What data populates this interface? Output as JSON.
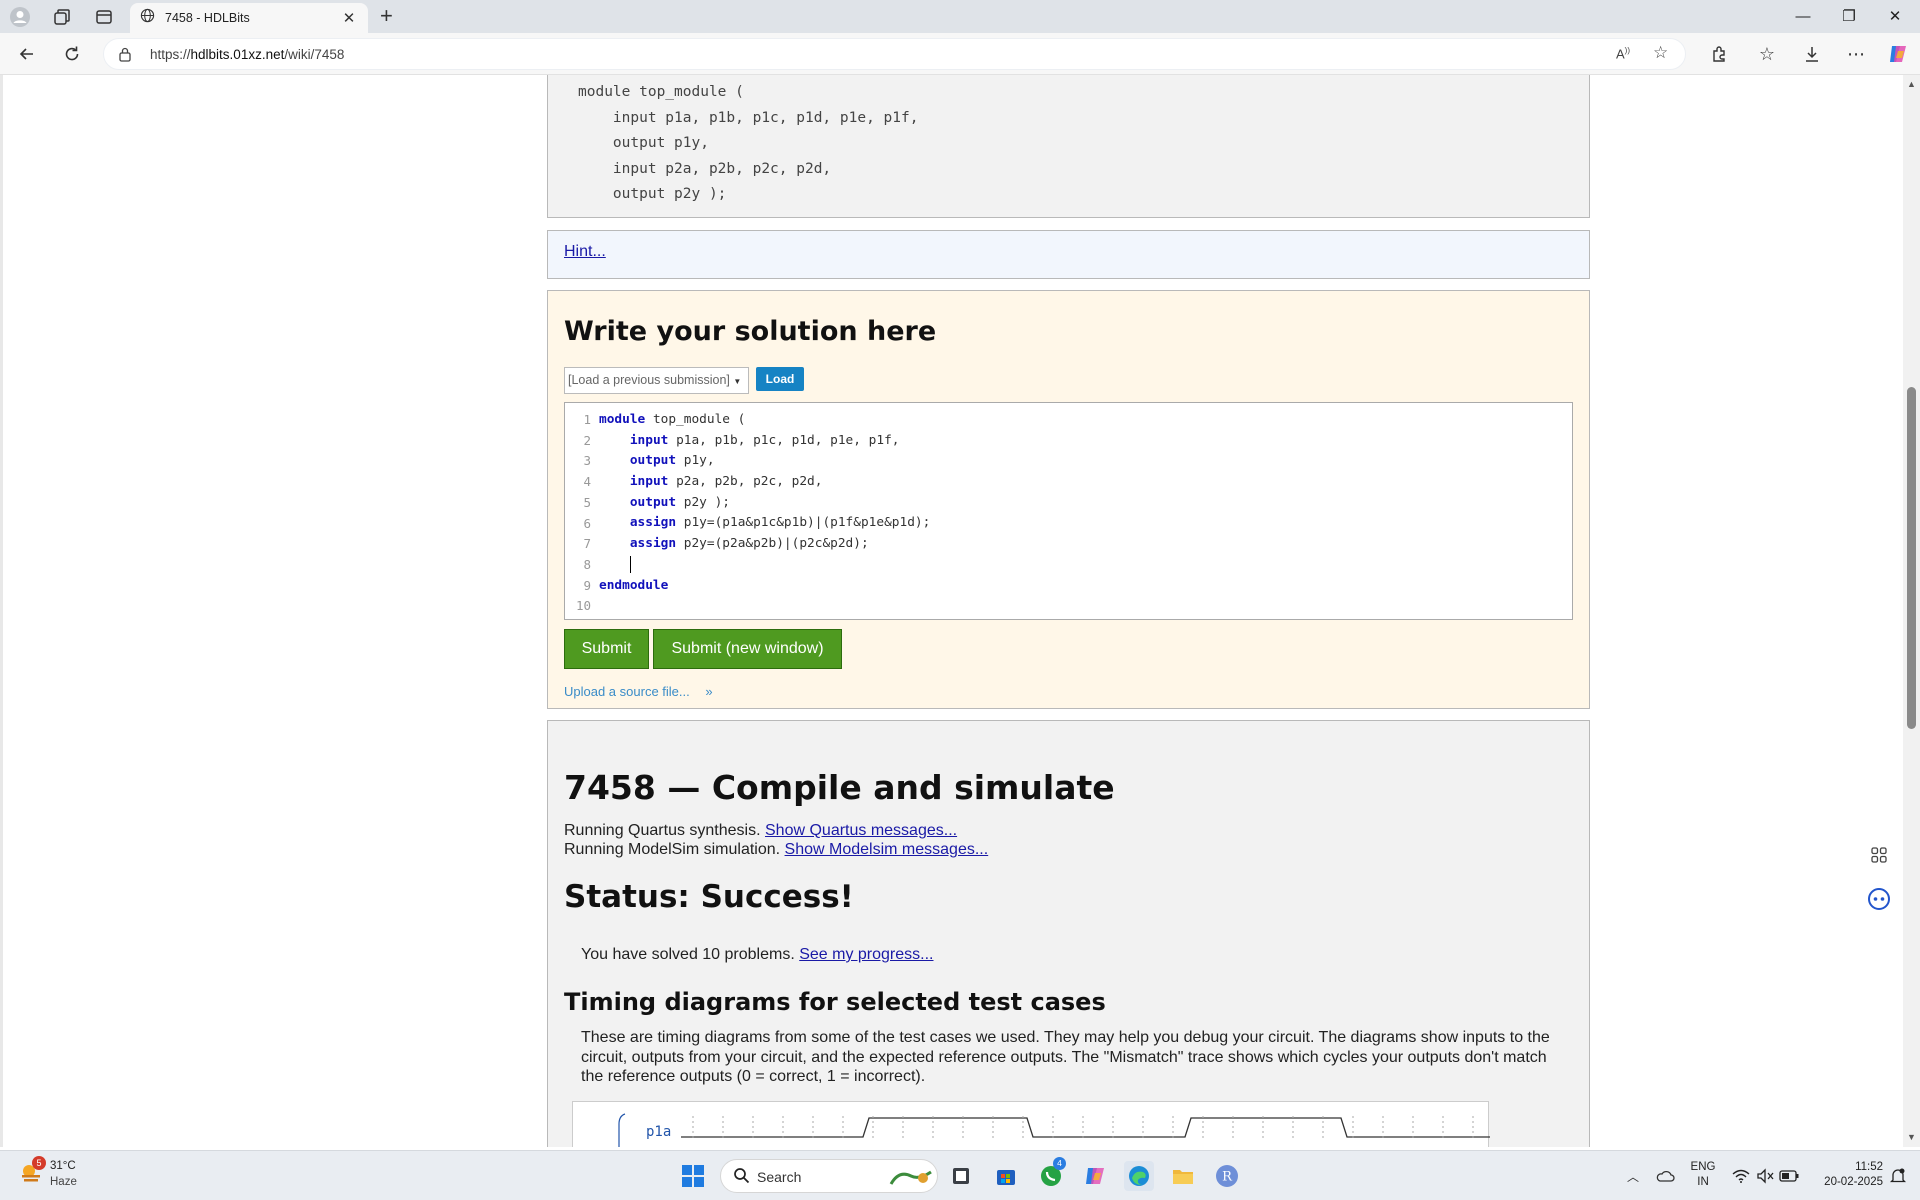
{
  "browser": {
    "tab_title": "7458 - HDLBits",
    "url_prefix": "https://",
    "url_host": "hdlbits.01xz.net",
    "url_path": "/wiki/7458",
    "window_controls": [
      "minimize",
      "restore",
      "close"
    ]
  },
  "page": {
    "module_decl": "module top_module (\n    input p1a, p1b, p1c, p1d, p1e, p1f,\n    output p1y,\n    input p2a, p2b, p2c, p2d,\n    output p2y );",
    "hint_link": "Hint...",
    "solution_title": "Write your solution here",
    "load_previous_placeholder": "[Load a previous submission]",
    "load_button": "Load",
    "editor": {
      "line_numbers": [
        "1",
        "2",
        "3",
        "4",
        "5",
        "6",
        "7",
        "8",
        "9",
        "10"
      ],
      "lines": [
        {
          "kw": "module",
          "rest": " top_module ("
        },
        {
          "indent": "    ",
          "kw": "input",
          "rest": " p1a, p1b, p1c, p1d, p1e, p1f,"
        },
        {
          "indent": "    ",
          "kw": "output",
          "rest": " p1y,"
        },
        {
          "indent": "    ",
          "kw": "input",
          "rest": " p2a, p2b, p2c, p2d,"
        },
        {
          "indent": "    ",
          "kw": "output",
          "rest": " p2y );"
        },
        {
          "indent": "    ",
          "kw": "assign",
          "rest": " p1y=(p1a&p1c&p1b)|(p1f&p1e&p1d);"
        },
        {
          "indent": "    ",
          "kw": "assign",
          "rest": " p2y=(p2a&p2b)|(p2c&p2d);"
        },
        {
          "indent": "    ",
          "kw": "",
          "rest": "",
          "caret": true
        },
        {
          "kw": "endmodule",
          "rest": ""
        },
        {
          "kw": "",
          "rest": ""
        }
      ]
    },
    "submit_button": "Submit",
    "submit_new_window_button": "Submit (new window)",
    "upload_link": "Upload a source file...",
    "results": {
      "title": "7458 — Compile and simulate",
      "quartus_text": "Running Quartus synthesis. ",
      "quartus_link": "Show Quartus messages...",
      "modelsim_text": "Running ModelSim simulation. ",
      "modelsim_link": "Show Modelsim messages...",
      "status": "Status: Success!",
      "progress_text": "You have solved 10 problems. ",
      "progress_link": "See my progress...",
      "timing_title": "Timing diagrams for selected test cases",
      "timing_desc": "These are timing diagrams from some of the test cases we used. They may help you debug your circuit. The diagrams show inputs to the circuit, outputs from your circuit, and the expected reference outputs. The \"Mismatch\" trace shows which cycles your outputs don't match the reference outputs (0 = correct, 1 = incorrect).",
      "wave_signal": "p1a"
    }
  },
  "taskbar": {
    "weather_badge": "5",
    "weather_temp": "31°C",
    "weather_cond": "Haze",
    "search_placeholder": "Search",
    "whatsapp_badge": "4",
    "lang_top": "ENG",
    "lang_bottom": "IN",
    "time": "11:52",
    "date": "20-02-2025"
  },
  "colors": {
    "solution_bg": "#fff7e8",
    "hint_bg": "#f2f6fd",
    "submit_green": "#4f9a20",
    "load_blue": "#1683c4",
    "keyword_blue": "#1111bb"
  }
}
